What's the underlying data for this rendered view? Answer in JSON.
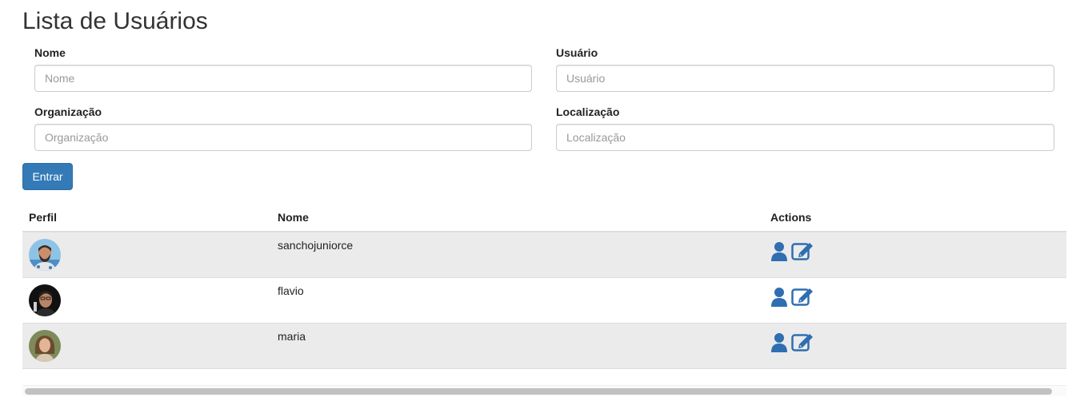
{
  "page": {
    "title": "Lista de Usuários"
  },
  "form": {
    "nome": {
      "label": "Nome",
      "placeholder": "Nome"
    },
    "usuario": {
      "label": "Usuário",
      "placeholder": "Usuário"
    },
    "organizacao": {
      "label": "Organização",
      "placeholder": "Organização"
    },
    "localizacao": {
      "label": "Localização",
      "placeholder": "Localização"
    },
    "submit_label": "Entrar"
  },
  "table": {
    "headers": {
      "perfil": "Perfil",
      "nome": "Nome",
      "actions": "Actions"
    },
    "rows": [
      {
        "nome": "sanchojuniorce",
        "avatar_icon": "avatar-bearded-man"
      },
      {
        "nome": "flavio",
        "avatar_icon": "avatar-man-dark"
      },
      {
        "nome": "maria",
        "avatar_icon": "avatar-woman"
      }
    ],
    "action_icons": [
      "user-icon",
      "edit-icon"
    ]
  },
  "colors": {
    "primary": "#337ab7",
    "stripe": "#ebebeb",
    "icon_blue": "#2f6eb1"
  }
}
